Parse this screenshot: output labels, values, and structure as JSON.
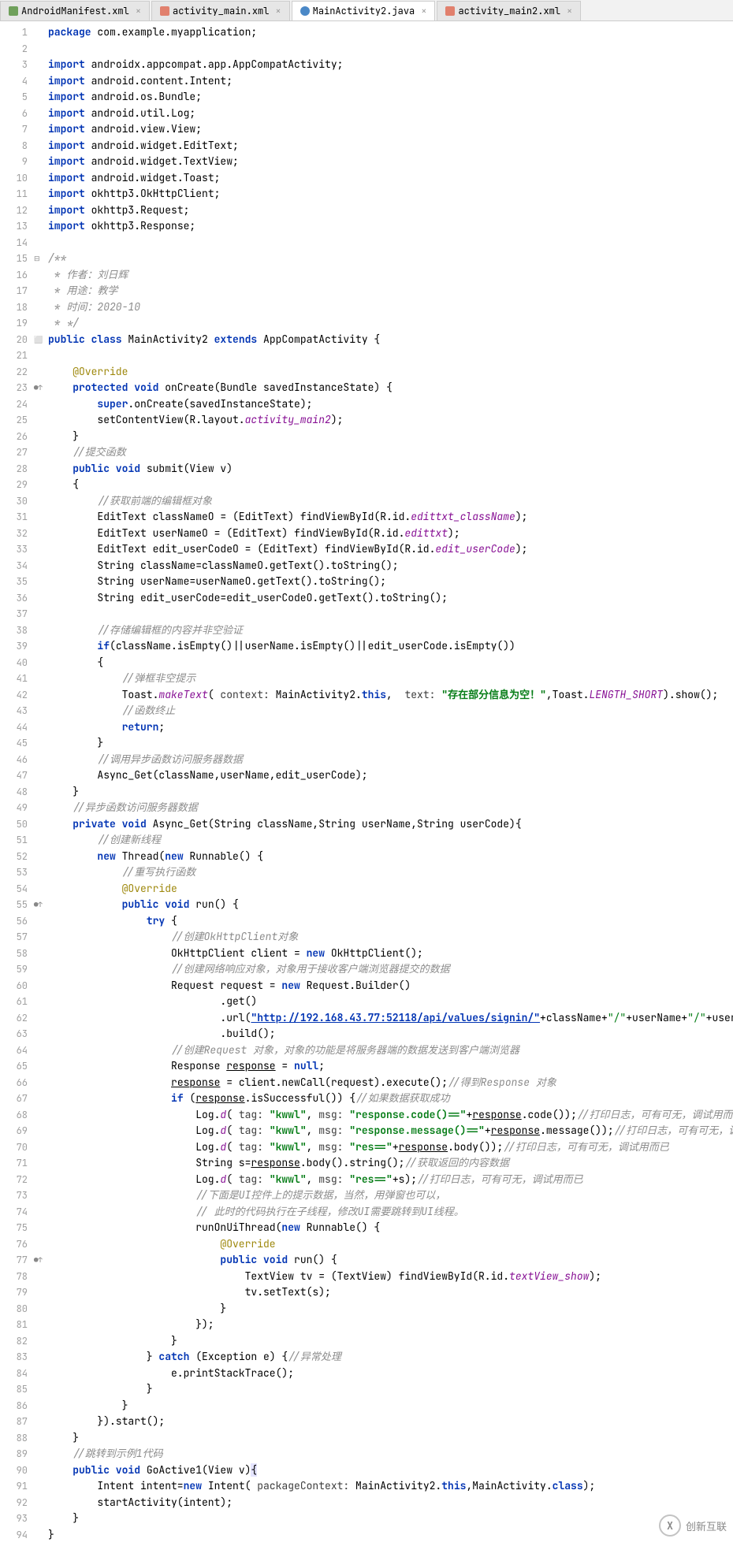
{
  "tabs": [
    {
      "icon": "#6fa05b",
      "label": "AndroidManifest.xml",
      "active": false
    },
    {
      "icon": "#e1806d",
      "label": "activity_main.xml",
      "active": false
    },
    {
      "icon": "#4a88c7",
      "label": "MainActivity2.java",
      "active": true
    },
    {
      "icon": "#e1806d",
      "label": "activity_main2.xml",
      "active": false
    }
  ],
  "lines": [
    [
      [
        "kw",
        "package"
      ],
      [
        "id",
        " com.example.myapplication;"
      ]
    ],
    [],
    [
      [
        "kw",
        "import"
      ],
      [
        "id",
        " androidx.appcompat.app.AppCompatActivity;"
      ]
    ],
    [
      [
        "kw",
        "import"
      ],
      [
        "id",
        " android.content.Intent;"
      ]
    ],
    [
      [
        "kw",
        "import"
      ],
      [
        "id",
        " android.os.Bundle;"
      ]
    ],
    [
      [
        "kw",
        "import"
      ],
      [
        "id",
        " android.util.Log;"
      ]
    ],
    [
      [
        "kw",
        "import"
      ],
      [
        "id",
        " android.view.View;"
      ]
    ],
    [
      [
        "kw",
        "import"
      ],
      [
        "id",
        " android.widget.EditText;"
      ]
    ],
    [
      [
        "kw",
        "import"
      ],
      [
        "id",
        " android.widget.TextView;"
      ]
    ],
    [
      [
        "kw",
        "import"
      ],
      [
        "id",
        " android.widget.Toast;"
      ]
    ],
    [
      [
        "kw",
        "import"
      ],
      [
        "id",
        " okhttp3.OkHttpClient;"
      ]
    ],
    [
      [
        "kw",
        "import"
      ],
      [
        "id",
        " okhttp3.Request;"
      ]
    ],
    [
      [
        "kw",
        "import"
      ],
      [
        "id",
        " okhttp3.Response;"
      ]
    ],
    [],
    [
      [
        "com",
        "/**"
      ]
    ],
    [
      [
        "com",
        " * 作者：刘日辉"
      ]
    ],
    [
      [
        "com",
        " * 用途：教学"
      ]
    ],
    [
      [
        "com",
        " * 时间：2020-10"
      ]
    ],
    [
      [
        "com",
        " * */"
      ]
    ],
    [
      [
        "kw",
        "public class"
      ],
      [
        "id",
        " MainActivity2 "
      ],
      [
        "kw",
        "extends"
      ],
      [
        "id",
        " AppCompatActivity {"
      ]
    ],
    [],
    [
      [
        "id",
        "    "
      ],
      [
        "ann",
        "@Override"
      ]
    ],
    [
      [
        "id",
        "    "
      ],
      [
        "kw",
        "protected void"
      ],
      [
        "id",
        " onCreate(Bundle savedInstanceState) {"
      ]
    ],
    [
      [
        "id",
        "        "
      ],
      [
        "kw",
        "super"
      ],
      [
        "id",
        ".onCreate(savedInstanceState);"
      ]
    ],
    [
      [
        "id",
        "        setContentView(R.layout."
      ],
      [
        "fld",
        "activity_main2"
      ],
      [
        "id",
        ");"
      ]
    ],
    [
      [
        "id",
        "    }"
      ]
    ],
    [
      [
        "id",
        "    "
      ],
      [
        "com",
        "//提交函数"
      ]
    ],
    [
      [
        "id",
        "    "
      ],
      [
        "kw",
        "public void"
      ],
      [
        "id",
        " submit(View v)"
      ]
    ],
    [
      [
        "id",
        "    {"
      ]
    ],
    [
      [
        "id",
        "        "
      ],
      [
        "com",
        "//获取前端的编辑框对象"
      ]
    ],
    [
      [
        "id",
        "        EditText classNameO = (EditText) findViewById(R.id."
      ],
      [
        "fld",
        "edittxt_className"
      ],
      [
        "id",
        ");"
      ]
    ],
    [
      [
        "id",
        "        EditText userNameO = (EditText) findViewById(R.id."
      ],
      [
        "fld",
        "edittxt"
      ],
      [
        "id",
        ");"
      ]
    ],
    [
      [
        "id",
        "        EditText edit_userCodeO = (EditText) findViewById(R.id."
      ],
      [
        "fld",
        "edit_userCode"
      ],
      [
        "id",
        ");"
      ]
    ],
    [
      [
        "id",
        "        String className=classNameO.getText().toString();"
      ]
    ],
    [
      [
        "id",
        "        String userName=userNameO.getText().toString();"
      ]
    ],
    [
      [
        "id",
        "        String edit_userCode=edit_userCodeO.getText().toString();"
      ]
    ],
    [],
    [
      [
        "id",
        "        "
      ],
      [
        "com",
        "//存储编辑框的内容并非空验证"
      ]
    ],
    [
      [
        "id",
        "        "
      ],
      [
        "kw",
        "if"
      ],
      [
        "id",
        "(className.isEmpty()||userName.isEmpty()||edit_userCode.isEmpty())"
      ]
    ],
    [
      [
        "id",
        "        {"
      ]
    ],
    [
      [
        "id",
        "            "
      ],
      [
        "com",
        "//弹框非空提示"
      ]
    ],
    [
      [
        "id",
        "            Toast."
      ],
      [
        "fld",
        "makeText"
      ],
      [
        "id",
        "( "
      ],
      [
        "param",
        "context:"
      ],
      [
        "id",
        " MainActivity2."
      ],
      [
        "kw",
        "this"
      ],
      [
        "id",
        ",  "
      ],
      [
        "param",
        "text:"
      ],
      [
        "str-b",
        " \"存在部分信息为空！\""
      ],
      [
        "id",
        ",Toast."
      ],
      [
        "fld",
        "LENGTH_SHORT"
      ],
      [
        "id",
        ").show();"
      ]
    ],
    [
      [
        "id",
        "            "
      ],
      [
        "com",
        "//函数终止"
      ]
    ],
    [
      [
        "id",
        "            "
      ],
      [
        "kw",
        "return"
      ],
      [
        "id",
        ";"
      ]
    ],
    [
      [
        "id",
        "        }"
      ]
    ],
    [
      [
        "id",
        "        "
      ],
      [
        "com",
        "//调用异步函数访问服务器数据"
      ]
    ],
    [
      [
        "id",
        "        Async_Get(className,userName,edit_userCode);"
      ]
    ],
    [
      [
        "id",
        "    }"
      ]
    ],
    [
      [
        "id",
        "    "
      ],
      [
        "com",
        "//异步函数访问服务器数据"
      ]
    ],
    [
      [
        "id",
        "    "
      ],
      [
        "kw",
        "private void"
      ],
      [
        "id",
        " Async_Get(String className,String userName,String userCode){"
      ]
    ],
    [
      [
        "id",
        "        "
      ],
      [
        "com",
        "//创建新线程"
      ]
    ],
    [
      [
        "id",
        "        "
      ],
      [
        "kw",
        "new"
      ],
      [
        "id",
        " Thread("
      ],
      [
        "kw",
        "new"
      ],
      [
        "id",
        " Runnable() {"
      ]
    ],
    [
      [
        "id",
        "            "
      ],
      [
        "com",
        "//重写执行函数"
      ]
    ],
    [
      [
        "id",
        "            "
      ],
      [
        "ann",
        "@Override"
      ]
    ],
    [
      [
        "id",
        "            "
      ],
      [
        "kw",
        "public void"
      ],
      [
        "id",
        " run() {"
      ]
    ],
    [
      [
        "id",
        "                "
      ],
      [
        "kw",
        "try"
      ],
      [
        "id",
        " {"
      ]
    ],
    [
      [
        "id",
        "                    "
      ],
      [
        "com",
        "//创建OkHttpClient对象"
      ]
    ],
    [
      [
        "id",
        "                    OkHttpClient client = "
      ],
      [
        "kw",
        "new"
      ],
      [
        "id",
        " OkHttpClient();"
      ]
    ],
    [
      [
        "id",
        "                    "
      ],
      [
        "com",
        "//创建网络响应对象，对象用于接收客户端浏览器提交的数据"
      ]
    ],
    [
      [
        "id",
        "                    Request request = "
      ],
      [
        "kw",
        "new"
      ],
      [
        "id",
        " Request.Builder()"
      ]
    ],
    [
      [
        "id",
        "                            .get()"
      ]
    ],
    [
      [
        "id",
        "                            .url("
      ],
      [
        "link",
        "\"http://192.168.43.77:52118/api/values/signin/\""
      ],
      [
        "id",
        "+className+"
      ],
      [
        "str",
        "\"/\""
      ],
      [
        "id",
        "+userName+"
      ],
      [
        "str",
        "\"/\""
      ],
      [
        "id",
        "+userCode)"
      ]
    ],
    [
      [
        "id",
        "                            .build();"
      ]
    ],
    [
      [
        "id",
        "                    "
      ],
      [
        "com",
        "//创建Request 对象，对象的功能是将服务器端的数据发送到客户端浏览器"
      ]
    ],
    [
      [
        "id",
        "                    Response "
      ],
      [
        "underline",
        "response"
      ],
      [
        "id",
        " = "
      ],
      [
        "kw",
        "null"
      ],
      [
        "id",
        ";"
      ]
    ],
    [
      [
        "id",
        "                    "
      ],
      [
        "underline",
        "response"
      ],
      [
        "id",
        " = client.newCall(request).execute();"
      ],
      [
        "com",
        "//得到Response 对象"
      ]
    ],
    [
      [
        "id",
        "                    "
      ],
      [
        "kw",
        "if"
      ],
      [
        "id",
        " ("
      ],
      [
        "underline",
        "response"
      ],
      [
        "id",
        ".isSuccessful()) {"
      ],
      [
        "com",
        "//如果数据获取成功"
      ]
    ],
    [
      [
        "id",
        "                        Log."
      ],
      [
        "fld",
        "d"
      ],
      [
        "id",
        "( "
      ],
      [
        "param",
        "tag:"
      ],
      [
        "str-b",
        " \"kwwl\""
      ],
      [
        "id",
        ", "
      ],
      [
        "param",
        "msg:"
      ],
      [
        "str-b",
        " \"response.code()==\""
      ],
      [
        "id",
        "+"
      ],
      [
        "underline",
        "response"
      ],
      [
        "id",
        ".code());"
      ],
      [
        "com",
        "//打印日志，可有可无，调试用而已"
      ]
    ],
    [
      [
        "id",
        "                        Log."
      ],
      [
        "fld",
        "d"
      ],
      [
        "id",
        "( "
      ],
      [
        "param",
        "tag:"
      ],
      [
        "str-b",
        " \"kwwl\""
      ],
      [
        "id",
        ", "
      ],
      [
        "param",
        "msg:"
      ],
      [
        "str-b",
        " \"response.message()==\""
      ],
      [
        "id",
        "+"
      ],
      [
        "underline",
        "response"
      ],
      [
        "id",
        ".message());"
      ],
      [
        "com",
        "//打印日志，可有可无，调试用而已"
      ]
    ],
    [
      [
        "id",
        "                        Log."
      ],
      [
        "fld",
        "d"
      ],
      [
        "id",
        "( "
      ],
      [
        "param",
        "tag:"
      ],
      [
        "str-b",
        " \"kwwl\""
      ],
      [
        "id",
        ", "
      ],
      [
        "param",
        "msg:"
      ],
      [
        "str-b",
        " \"res==\""
      ],
      [
        "id",
        "+"
      ],
      [
        "underline",
        "response"
      ],
      [
        "id",
        ".body());"
      ],
      [
        "com",
        "//打印日志，可有可无，调试用而已"
      ]
    ],
    [
      [
        "id",
        "                        String s="
      ],
      [
        "underline",
        "response"
      ],
      [
        "id",
        ".body().string();"
      ],
      [
        "com",
        "//获取返回的内容数据"
      ]
    ],
    [
      [
        "id",
        "                        Log."
      ],
      [
        "fld",
        "d"
      ],
      [
        "id",
        "( "
      ],
      [
        "param",
        "tag:"
      ],
      [
        "str-b",
        " \"kwwl\""
      ],
      [
        "id",
        ", "
      ],
      [
        "param",
        "msg:"
      ],
      [
        "str-b",
        " \"res==\""
      ],
      [
        "id",
        "+s);"
      ],
      [
        "com",
        "//打印日志，可有可无，调试用而已"
      ]
    ],
    [
      [
        "id",
        "                        "
      ],
      [
        "com",
        "//下面是UI控件上的提示数据，当然，用弹窗也可以，"
      ]
    ],
    [
      [
        "id",
        "                        "
      ],
      [
        "com",
        "// 此时的代码执行在子线程，修改UI需要跳转到UI线程。"
      ]
    ],
    [
      [
        "id",
        "                        runOnUiThread("
      ],
      [
        "kw",
        "new"
      ],
      [
        "id",
        " Runnable() {"
      ]
    ],
    [
      [
        "id",
        "                            "
      ],
      [
        "ann",
        "@Override"
      ]
    ],
    [
      [
        "id",
        "                            "
      ],
      [
        "kw",
        "public void"
      ],
      [
        "id",
        " run() {"
      ]
    ],
    [
      [
        "id",
        "                                TextView tv = (TextView) findViewById(R.id."
      ],
      [
        "fld",
        "textView_show"
      ],
      [
        "id",
        ");"
      ]
    ],
    [
      [
        "id",
        "                                tv.setText(s);"
      ]
    ],
    [
      [
        "id",
        "                            }"
      ]
    ],
    [
      [
        "id",
        "                        });"
      ]
    ],
    [
      [
        "id",
        "                    }"
      ]
    ],
    [
      [
        "id",
        "                } "
      ],
      [
        "kw",
        "catch"
      ],
      [
        "id",
        " (Exception e) {"
      ],
      [
        "com",
        "//异常处理"
      ]
    ],
    [
      [
        "id",
        "                    e.printStackTrace();"
      ]
    ],
    [
      [
        "id",
        "                }"
      ]
    ],
    [
      [
        "id",
        "            }"
      ]
    ],
    [
      [
        "id",
        "        }).start();"
      ]
    ],
    [
      [
        "id",
        "    }"
      ]
    ],
    [
      [
        "id",
        "    "
      ],
      [
        "com",
        "//跳转到示例1代码"
      ]
    ],
    [
      [
        "id",
        "    "
      ],
      [
        "kw",
        "public void"
      ],
      [
        "id",
        " GoActive1(View v)"
      ],
      [
        "hl",
        "{"
      ]
    ],
    [
      [
        "id",
        "        Intent intent="
      ],
      [
        "kw",
        "new"
      ],
      [
        "id",
        " Intent( "
      ],
      [
        "param",
        "packageContext:"
      ],
      [
        "id",
        " MainActivity2."
      ],
      [
        "kw",
        "this"
      ],
      [
        "id",
        ",MainActivity."
      ],
      [
        "kw",
        "class"
      ],
      [
        "id",
        ");"
      ]
    ],
    [
      [
        "id",
        "        startActivity(intent);"
      ]
    ],
    [
      [
        "id",
        "    }"
      ]
    ],
    [
      [
        "id",
        "}"
      ]
    ]
  ],
  "logo": "创新互联",
  "line_count": 94
}
